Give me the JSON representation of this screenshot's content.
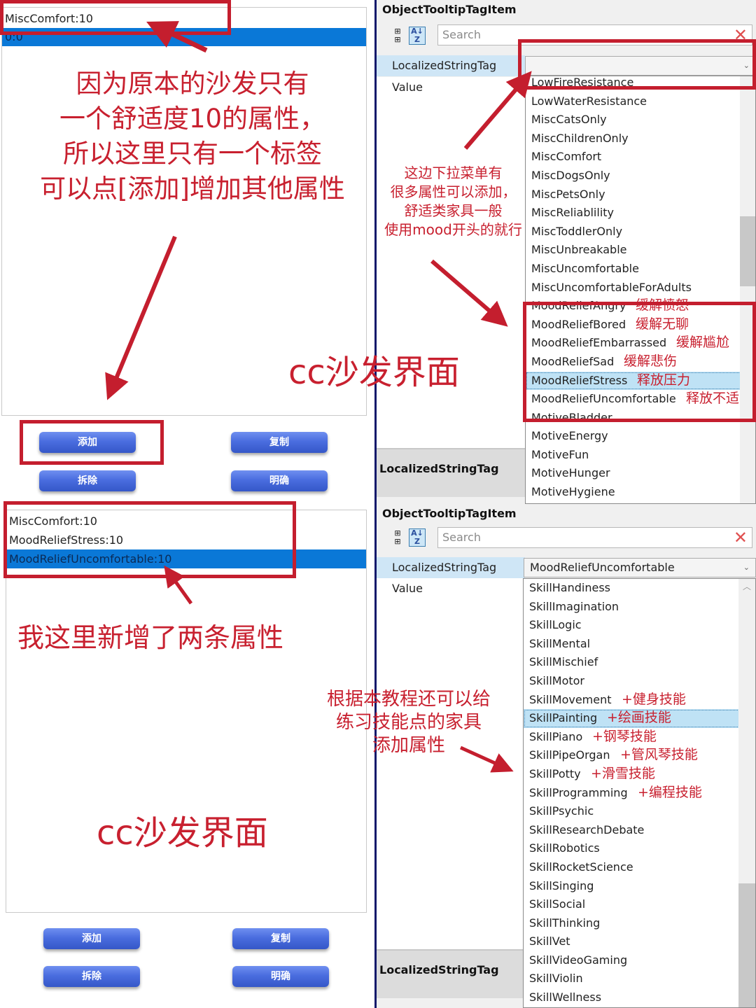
{
  "top_left": {
    "list_items": [
      {
        "label": "MiscComfort:10",
        "selected": false
      },
      {
        "label": "0:0",
        "selected": true
      }
    ]
  },
  "bottom_left": {
    "list_items": [
      {
        "label": "MiscComfort:10",
        "selected": false
      },
      {
        "label": "MoodReliefStress:10",
        "selected": false
      },
      {
        "label": "MoodReliefUncomfortable:10",
        "selected": true
      }
    ]
  },
  "buttons": {
    "add": "添加",
    "copy": "复制",
    "remove": "拆除",
    "clear": "明确"
  },
  "property_grid_top": {
    "title": "ObjectTooltipTagItem",
    "search_placeholder": "Search",
    "rows": [
      {
        "name": "LocalizedStringTag",
        "value": ""
      },
      {
        "name": "Value",
        "value": ""
      }
    ],
    "description_label": "LocalizedStringTag",
    "dropdown_items": [
      {
        "label": "LowFireResistance",
        "note": ""
      },
      {
        "label": "LowWaterResistance",
        "note": ""
      },
      {
        "label": "MiscCatsOnly",
        "note": ""
      },
      {
        "label": "MiscChildrenOnly",
        "note": ""
      },
      {
        "label": "MiscComfort",
        "note": ""
      },
      {
        "label": "MiscDogsOnly",
        "note": ""
      },
      {
        "label": "MiscPetsOnly",
        "note": ""
      },
      {
        "label": "MiscReliablility",
        "note": ""
      },
      {
        "label": "MiscToddlerOnly",
        "note": ""
      },
      {
        "label": "MiscUnbreakable",
        "note": ""
      },
      {
        "label": "MiscUncomfortable",
        "note": ""
      },
      {
        "label": "MiscUncomfortableForAdults",
        "note": ""
      },
      {
        "label": "MoodReliefAngry",
        "note": "缓解愤怒"
      },
      {
        "label": "MoodReliefBored",
        "note": "缓解无聊"
      },
      {
        "label": "MoodReliefEmbarrassed",
        "note": "缓解尴尬"
      },
      {
        "label": "MoodReliefSad",
        "note": "缓解悲伤"
      },
      {
        "label": "MoodReliefStress",
        "note": "释放压力",
        "selected": true
      },
      {
        "label": "MoodReliefUncomfortable",
        "note": "释放不适"
      },
      {
        "label": "MotiveBladder",
        "note": ""
      },
      {
        "label": "MotiveEnergy",
        "note": ""
      },
      {
        "label": "MotiveFun",
        "note": ""
      },
      {
        "label": "MotiveHunger",
        "note": ""
      },
      {
        "label": "MotiveHygiene",
        "note": ""
      }
    ]
  },
  "property_grid_bottom": {
    "title": "ObjectTooltipTagItem",
    "search_placeholder": "Search",
    "rows": [
      {
        "name": "LocalizedStringTag",
        "value": "MoodReliefUncomfortable"
      },
      {
        "name": "Value",
        "value": ""
      }
    ],
    "description_label": "LocalizedStringTag",
    "dropdown_items": [
      {
        "label": "SkillHandiness",
        "note": ""
      },
      {
        "label": "SkillImagination",
        "note": ""
      },
      {
        "label": "SkillLogic",
        "note": ""
      },
      {
        "label": "SkillMental",
        "note": ""
      },
      {
        "label": "SkillMischief",
        "note": ""
      },
      {
        "label": "SkillMotor",
        "note": ""
      },
      {
        "label": "SkillMovement",
        "note": "+健身技能"
      },
      {
        "label": "SkillPainting",
        "note": "+绘画技能",
        "selected": true
      },
      {
        "label": "SkillPiano",
        "note": "+钢琴技能"
      },
      {
        "label": "SkillPipeOrgan",
        "note": "+管风琴技能"
      },
      {
        "label": "SkillPotty",
        "note": "+滑雪技能"
      },
      {
        "label": "SkillProgramming",
        "note": "+编程技能"
      },
      {
        "label": "SkillPsychic",
        "note": ""
      },
      {
        "label": "SkillResearchDebate",
        "note": ""
      },
      {
        "label": "SkillRobotics",
        "note": ""
      },
      {
        "label": "SkillRocketScience",
        "note": ""
      },
      {
        "label": "SkillSinging",
        "note": ""
      },
      {
        "label": "SkillSocial",
        "note": ""
      },
      {
        "label": "SkillThinking",
        "note": ""
      },
      {
        "label": "SkillVet",
        "note": ""
      },
      {
        "label": "SkillVideoGaming",
        "note": ""
      },
      {
        "label": "SkillViolin",
        "note": ""
      },
      {
        "label": "SkillWellness",
        "note": ""
      }
    ]
  },
  "annotations": {
    "top_left_lines": [
      "因为原本的沙发只有",
      "一个舒适度10的属性，",
      "所以这里只有一个标签",
      "可以点[添加]增加其他属性"
    ],
    "dropdown_hint_lines": [
      "这边下拉菜单有",
      "很多属性可以添加，",
      "舒适类家具一般",
      "使用mood开头的就行"
    ],
    "cc_label_top": "cc沙发界面",
    "added_note": "我这里新增了两条属性",
    "skills_hint_lines": [
      "根据本教程还可以给",
      "练习技能点的家具",
      "添加属性"
    ],
    "cc_label_bottom": "cc沙发界面"
  },
  "colors": {
    "annotation_red": "#c8202f",
    "selection_blue": "#0a78d7",
    "button_blue": "#4a6ddf"
  }
}
